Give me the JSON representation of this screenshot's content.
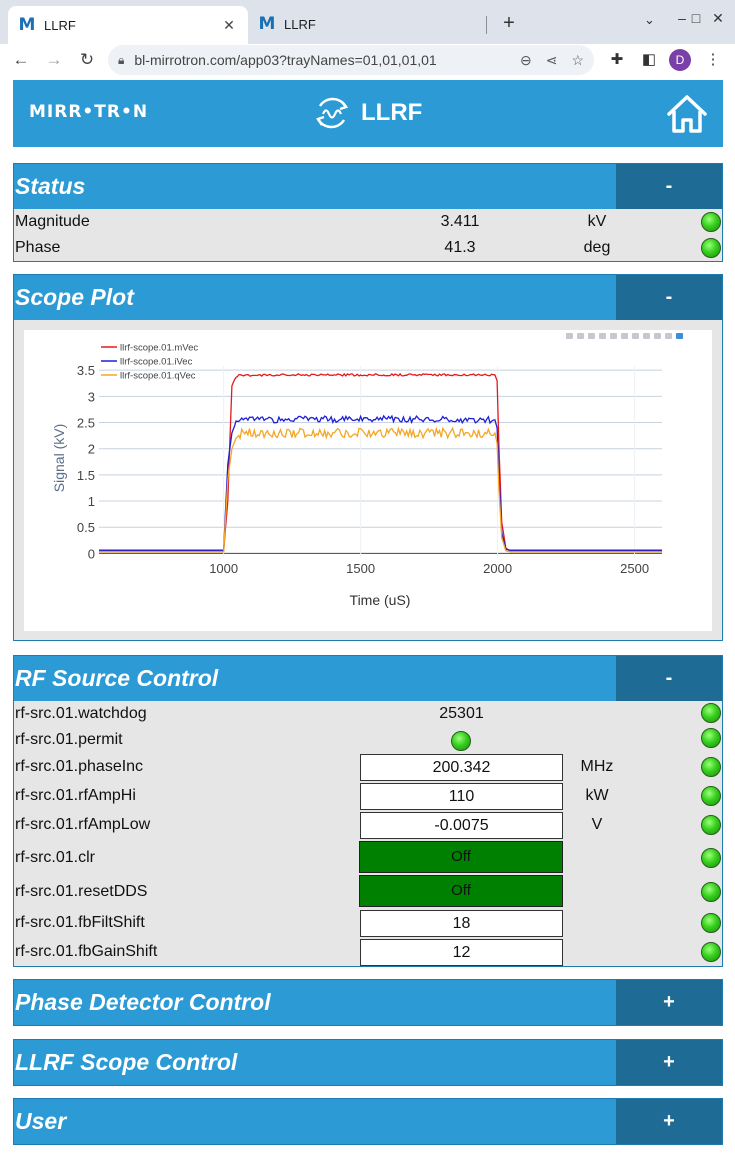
{
  "browser": {
    "tabs": [
      {
        "favicon": "M",
        "title": "LLRF",
        "active": true
      },
      {
        "favicon": "M",
        "title": "LLRF",
        "active": false
      }
    ],
    "url": "bl-mirrotron.com/app03?trayNames=01,01,01,01",
    "profile_initial": "D",
    "icons": {
      "back": "back-arrow-icon",
      "forward": "forward-arrow-icon",
      "reload": "reload-icon",
      "lock": "lock-icon"
    }
  },
  "header": {
    "logo_text": "MIRR•TR•N",
    "app_title": "LLRF"
  },
  "status": {
    "title": "Status",
    "toggle": "-",
    "rows": [
      {
        "label": "Magnitude",
        "value": "3.411",
        "unit": "kV"
      },
      {
        "label": "Phase",
        "value": "41.3",
        "unit": "deg"
      }
    ]
  },
  "scope": {
    "title": "Scope Plot",
    "toggle": "-"
  },
  "chart_data": {
    "type": "line",
    "xlabel": "Time (uS)",
    "ylabel": "Signal (kV)",
    "xlim": [
      545,
      2600
    ],
    "ylim": [
      -0.05,
      3.58
    ],
    "xticks": [
      1000,
      1500,
      2000,
      2500
    ],
    "yticks": [
      0,
      0.5,
      1,
      1.5,
      2,
      2.5,
      3,
      3.5
    ],
    "ytick_labels": [
      "0",
      "0.5",
      "1",
      "1.5",
      "2",
      "2.5",
      "3",
      "3.5"
    ],
    "legend_position": "top-left",
    "series": [
      {
        "name": "llrf-scope.01.mVec",
        "color": "#e31a1c",
        "x": [
          545,
          1000,
          1015,
          1030,
          1045,
          1060,
          1200,
          1500,
          1800,
          1990,
          1998,
          2005,
          2015,
          2030,
          2045,
          2100,
          2600
        ],
        "y": [
          0.05,
          0.05,
          1.0,
          3.2,
          3.38,
          3.4,
          3.41,
          3.41,
          3.41,
          3.41,
          3.3,
          2.0,
          0.6,
          0.1,
          0.05,
          0.05,
          0.05
        ]
      },
      {
        "name": "llrf-scope.01.iVec",
        "color": "#1f1fd6",
        "x": [
          545,
          1000,
          1015,
          1030,
          1045,
          1060,
          1100,
          1500,
          1800,
          1990,
          1998,
          2005,
          2015,
          2030,
          2045,
          2100,
          2600
        ],
        "y": [
          0.06,
          0.06,
          1.7,
          2.3,
          2.5,
          2.55,
          2.55,
          2.57,
          2.56,
          2.55,
          2.4,
          1.5,
          0.4,
          0.08,
          0.06,
          0.06,
          0.06
        ]
      },
      {
        "name": "llrf-scope.01.qVec",
        "color": "#f5a623",
        "x": [
          545,
          1000,
          1015,
          1030,
          1045,
          1060,
          1100,
          1500,
          1800,
          1990,
          1998,
          2005,
          2015,
          2030,
          2045,
          2100,
          2600
        ],
        "y": [
          0.03,
          0.03,
          1.4,
          2.0,
          2.2,
          2.28,
          2.3,
          2.3,
          2.3,
          2.3,
          2.1,
          1.2,
          0.3,
          0.05,
          0.03,
          0.03,
          0.03
        ]
      }
    ]
  },
  "rf_source": {
    "title": "RF Source Control",
    "toggle": "-",
    "rows": [
      {
        "label": "rf-src.01.watchdog",
        "kind": "text",
        "value": "25301",
        "unit": ""
      },
      {
        "label": "rf-src.01.permit",
        "kind": "led",
        "value": "",
        "unit": ""
      },
      {
        "label": "rf-src.01.phaseInc",
        "kind": "input",
        "value": "200.342",
        "unit": "MHz"
      },
      {
        "label": "rf-src.01.rfAmpHi",
        "kind": "input",
        "value": "110",
        "unit": "kW"
      },
      {
        "label": "rf-src.01.rfAmpLow",
        "kind": "input",
        "value": "-0.0075",
        "unit": "V"
      },
      {
        "label": "rf-src.01.clr",
        "kind": "button",
        "value": "Off",
        "unit": ""
      },
      {
        "label": "rf-src.01.resetDDS",
        "kind": "button",
        "value": "Off",
        "unit": ""
      },
      {
        "label": "rf-src.01.fbFiltShift",
        "kind": "input",
        "value": "18",
        "unit": ""
      },
      {
        "label": "rf-src.01.fbGainShift",
        "kind": "input",
        "value": "12",
        "unit": ""
      }
    ]
  },
  "phase_detector": {
    "title": "Phase Detector Control",
    "toggle": "+"
  },
  "llrf_scope": {
    "title": "LLRF Scope Control",
    "toggle": "+"
  },
  "user": {
    "title": "User",
    "toggle": "+"
  },
  "colors": {
    "panel_blue": "#2b9ad5",
    "toggle_blue": "#1e6c96",
    "led_green": "#36d01e",
    "button_green": "#008000"
  }
}
